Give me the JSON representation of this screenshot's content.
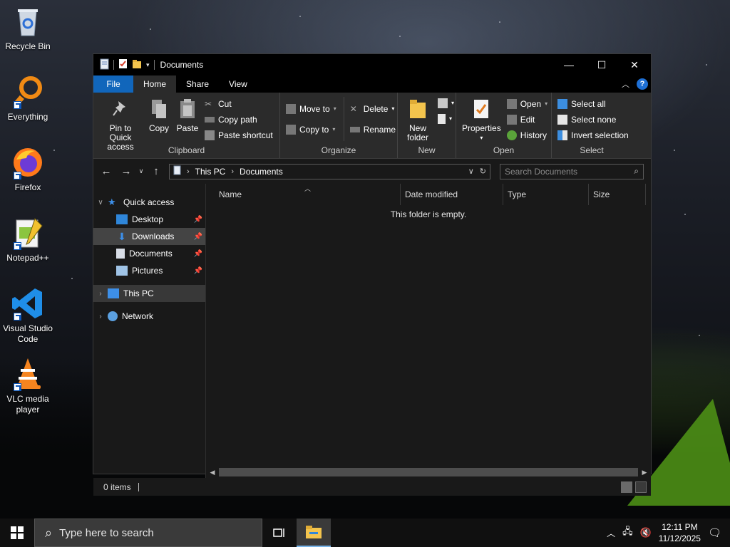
{
  "desktop": {
    "icons": [
      {
        "label": "Recycle Bin",
        "icon": "recycle-bin-icon"
      },
      {
        "label": "Everything",
        "icon": "everything-search-icon"
      },
      {
        "label": "Firefox",
        "icon": "firefox-icon"
      },
      {
        "label": "Notepad++",
        "icon": "notepad-plus-plus-icon"
      },
      {
        "label": "Visual Studio Code",
        "icon": "vscode-icon"
      },
      {
        "label": "VLC media player",
        "icon": "vlc-icon"
      }
    ]
  },
  "window": {
    "title": "Documents",
    "controls": {
      "minimize": "—",
      "maximize": "☐",
      "close": "✕"
    }
  },
  "menu": {
    "file": "File",
    "home": "Home",
    "share": "Share",
    "view": "View"
  },
  "ribbon": {
    "clipboard": {
      "label": "Clipboard",
      "pin": "Pin to Quick access",
      "copy": "Copy",
      "paste": "Paste",
      "cut": "Cut",
      "copy_path": "Copy path",
      "paste_shortcut": "Paste shortcut"
    },
    "organize": {
      "label": "Organize",
      "move_to": "Move to",
      "copy_to": "Copy to",
      "delete": "Delete",
      "rename": "Rename"
    },
    "new": {
      "label": "New",
      "new_folder": "New folder"
    },
    "open": {
      "label": "Open",
      "properties": "Properties",
      "open": "Open",
      "edit": "Edit",
      "history": "History"
    },
    "select": {
      "label": "Select",
      "select_all": "Select all",
      "select_none": "Select none",
      "invert": "Invert selection"
    }
  },
  "address": {
    "crumbs": [
      "This PC",
      "Documents"
    ],
    "search_placeholder": "Search Documents"
  },
  "nav": {
    "quick_access": "Quick access",
    "desktop": "Desktop",
    "downloads": "Downloads",
    "documents": "Documents",
    "pictures": "Pictures",
    "this_pc": "This PC",
    "network": "Network"
  },
  "columns": {
    "name": "Name",
    "date_modified": "Date modified",
    "type": "Type",
    "size": "Size"
  },
  "content": {
    "empty_message": "This folder is empty."
  },
  "status": {
    "items": "0 items"
  },
  "taskbar": {
    "search_placeholder": "Type here to search",
    "time": "12:11 PM",
    "date": "11/12/2025"
  },
  "colors": {
    "accent": "#1166bb",
    "window_bg": "#191919",
    "ribbon_bg": "#2b2b2b",
    "taskbar_bg": "#101010"
  }
}
